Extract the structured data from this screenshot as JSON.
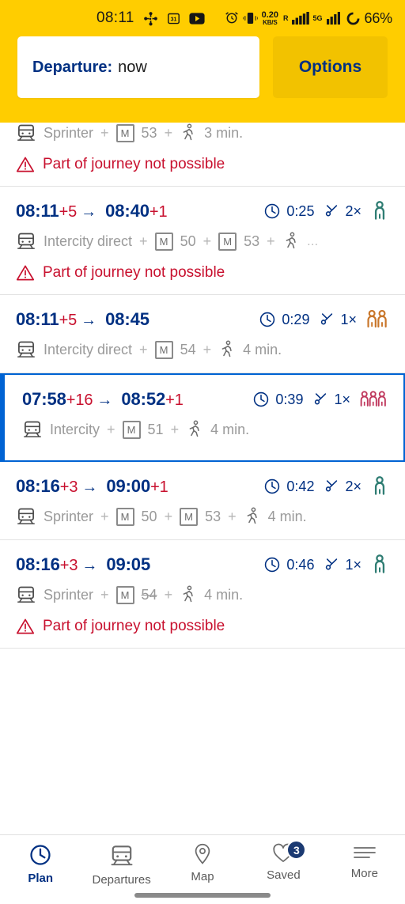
{
  "statusbar": {
    "time": "08:11",
    "left_icons": [
      "pinwheel-icon",
      "calendar-icon",
      "youtube-icon"
    ],
    "calendar_day": "31",
    "net_speed_value": "0.20",
    "net_speed_unit": "KB/S",
    "roaming_letter": "R",
    "network_label": "5G",
    "battery_percent": "66%",
    "right_icons": [
      "alarm-icon",
      "vibrate-icon",
      "signal-icon",
      "signal-icon",
      "battery-icon"
    ]
  },
  "header": {
    "departure_label": "Departure:",
    "departure_value": "now",
    "options_label": "Options",
    "accent_yellow": "#ffcd00",
    "accent_blue": "#003082"
  },
  "colors": {
    "brand_blue": "#003082",
    "selected_border": "#0063d3",
    "alert_red": "#c8102e",
    "occupancy_low": "#2f7d73",
    "occupancy_medium": "#c9762a",
    "occupancy_high": "#c0395e",
    "muted_text": "#9a9a9a"
  },
  "warning_text": "Part of journey not possible",
  "journeys": [
    {
      "partial": true,
      "selected": false,
      "depart": "",
      "depart_delay": "",
      "arrive": "",
      "arrive_delay": "",
      "duration": "",
      "transfers": "",
      "occupancy": "",
      "legs": [
        {
          "type": "train",
          "name": "Sprinter"
        },
        {
          "type": "metro",
          "badge": "M",
          "num": "53"
        },
        {
          "type": "walk",
          "name": "3 min."
        }
      ],
      "warning": "Part of journey not possible"
    },
    {
      "partial": false,
      "selected": false,
      "depart": "08:11",
      "depart_delay": "+5",
      "arrive": "08:40",
      "arrive_delay": "+1",
      "duration": "0:25",
      "transfers": "2×",
      "occupancy": "low",
      "legs": [
        {
          "type": "train",
          "name": "Intercity direct"
        },
        {
          "type": "metro",
          "badge": "M",
          "num": "50"
        },
        {
          "type": "metro",
          "badge": "M",
          "num": "53"
        },
        {
          "type": "walk",
          "name": "…"
        }
      ],
      "warning": "Part of journey not possible"
    },
    {
      "partial": false,
      "selected": false,
      "depart": "08:11",
      "depart_delay": "+5",
      "arrive": "08:45",
      "arrive_delay": "",
      "duration": "0:29",
      "transfers": "1×",
      "occupancy": "medium",
      "legs": [
        {
          "type": "train",
          "name": "Intercity direct"
        },
        {
          "type": "metro",
          "badge": "M",
          "num": "54"
        },
        {
          "type": "walk",
          "name": "4 min."
        }
      ],
      "warning": ""
    },
    {
      "partial": false,
      "selected": true,
      "depart": "07:58",
      "depart_delay": "+16",
      "arrive": "08:52",
      "arrive_delay": "+1",
      "duration": "0:39",
      "transfers": "1×",
      "occupancy": "high",
      "legs": [
        {
          "type": "train",
          "name": "Intercity"
        },
        {
          "type": "metro",
          "badge": "M",
          "num": "51"
        },
        {
          "type": "walk",
          "name": "4 min."
        }
      ],
      "warning": ""
    },
    {
      "partial": false,
      "selected": false,
      "depart": "08:16",
      "depart_delay": "+3",
      "arrive": "09:00",
      "arrive_delay": "+1",
      "duration": "0:42",
      "transfers": "2×",
      "occupancy": "low",
      "legs": [
        {
          "type": "train",
          "name": "Sprinter"
        },
        {
          "type": "metro",
          "badge": "M",
          "num": "50"
        },
        {
          "type": "metro",
          "badge": "M",
          "num": "53"
        },
        {
          "type": "walk",
          "name": "4 min."
        }
      ],
      "warning": ""
    },
    {
      "partial": false,
      "selected": false,
      "depart": "08:16",
      "depart_delay": "+3",
      "arrive": "09:05",
      "arrive_delay": "",
      "duration": "0:46",
      "transfers": "1×",
      "occupancy": "low",
      "legs": [
        {
          "type": "train",
          "name": "Sprinter"
        },
        {
          "type": "metro",
          "badge": "M",
          "num": "54",
          "struck": true
        },
        {
          "type": "walk",
          "name": "4 min."
        }
      ],
      "warning": "Part of journey not possible"
    }
  ],
  "bottomnav": {
    "items": [
      {
        "label": "Plan",
        "icon": "clock-icon",
        "active": true,
        "badge": ""
      },
      {
        "label": "Departures",
        "icon": "train-icon",
        "active": false,
        "badge": ""
      },
      {
        "label": "Map",
        "icon": "map-pin-icon",
        "active": false,
        "badge": ""
      },
      {
        "label": "Saved",
        "icon": "heart-icon",
        "active": false,
        "badge": "3"
      },
      {
        "label": "More",
        "icon": "menu-icon",
        "active": false,
        "badge": ""
      }
    ]
  }
}
